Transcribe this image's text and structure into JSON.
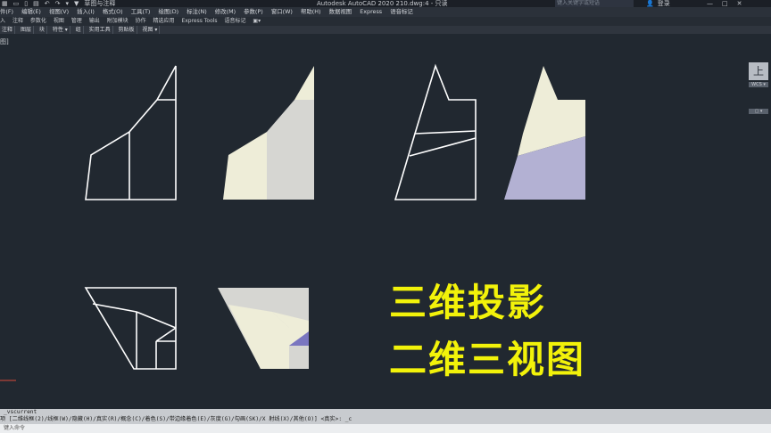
{
  "titlebar": {
    "quick_access": [
      "▦",
      "▭",
      "▯",
      "▤",
      "↶",
      "↷",
      "▾",
      "▼"
    ],
    "workspace": "草图与注释",
    "title": "Autodesk AutoCAD 2020   210.dwg:4 - 只读",
    "search_placeholder": "键入关键字或短语",
    "user_label": "登录",
    "window_controls": [
      "—",
      "□",
      "✕"
    ]
  },
  "menubar": {
    "items": [
      "件(F)",
      "编辑(E)",
      "视图(V)",
      "插入(I)",
      "格式(O)",
      "工具(T)",
      "绘图(D)",
      "标注(N)",
      "修改(M)",
      "参数(P)",
      "窗口(W)",
      "帮助(H)",
      "数据视图",
      "Express",
      "语音标记"
    ]
  },
  "ribbon_tabs": {
    "items": [
      "入",
      "注释",
      "参数化",
      "视图",
      "管理",
      "输出",
      "附加模块",
      "协作",
      "精选应用",
      "Express Tools",
      "语音标记",
      "▣▾"
    ]
  },
  "ribbon_panels": {
    "items": [
      "注释",
      "图层",
      "块",
      "特性 ▾",
      "组",
      "实用工具",
      "剪贴板",
      "视图 ▾"
    ]
  },
  "side_tab": "图]",
  "viewcube": {
    "label": "上",
    "nav1": "WCS ▾",
    "nav2": "▢ ▾"
  },
  "overlay_text": {
    "line1": "三维投影",
    "line2": "二维三视图"
  },
  "command": {
    "history_line1": "_vscurrent",
    "history_line2": "项 [二维线框(2)/线框(W)/隐藏(H)/真实(R)/概念(C)/着色(S)/带边缘着色(E)/灰度(G)/勾画(SK)/X 射线(X)/其他(O)] <真实>: _c",
    "input_placeholder": "键入命令"
  },
  "colors": {
    "canvas": "#212830",
    "line": "#ffffff",
    "face_light": "#eeedd8",
    "face_gray": "#d6d6d2",
    "face_purple": "#b3b1d3",
    "face_deep_purple": "#7a76c0",
    "overlay_text": "#f2f20a"
  }
}
